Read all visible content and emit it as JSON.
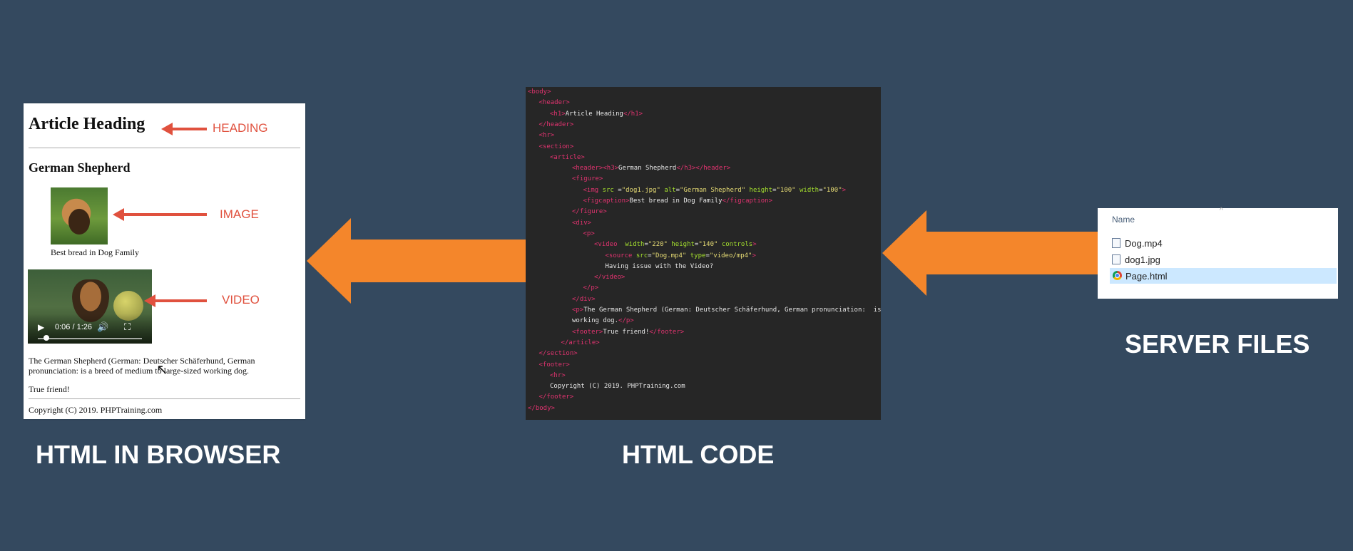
{
  "browser": {
    "heading": "Article Heading",
    "heading_annotation": "HEADING",
    "subheading": "German Shepherd",
    "image_annotation": "IMAGE",
    "caption": "Best bread in Dog Family",
    "video_annotation": "VIDEO",
    "video_time": "0:06 / 1:26",
    "paragraph": "The German Shepherd (German: Deutscher Schäferhund, German pronunciation: is a breed of medium to large-sized working dog.",
    "footer_text": "True friend!",
    "copyright": "Copyright (C) 2019. PHPTraining.com"
  },
  "code": {
    "lines": [
      {
        "indent": 0,
        "parts": [
          [
            "tg",
            "<body>"
          ]
        ]
      },
      {
        "indent": 1,
        "parts": [
          [
            "tg",
            "<header>"
          ]
        ]
      },
      {
        "indent": 2,
        "parts": [
          [
            "tg",
            "<h1>"
          ],
          [
            "tx",
            "Article Heading"
          ],
          [
            "tg",
            "</h1>"
          ]
        ]
      },
      {
        "indent": 1,
        "parts": [
          [
            "tg",
            "</header>"
          ]
        ]
      },
      {
        "indent": 1,
        "parts": [
          [
            "tg",
            "<hr>"
          ]
        ]
      },
      {
        "indent": 1,
        "parts": [
          [
            "tg",
            "<section>"
          ]
        ]
      },
      {
        "indent": 2,
        "parts": [
          [
            "tg",
            "<article>"
          ]
        ]
      },
      {
        "indent": 4,
        "parts": [
          [
            "tg",
            "<header>"
          ],
          [
            "tg",
            "<h3>"
          ],
          [
            "tx",
            "German Shepherd"
          ],
          [
            "tg",
            "</h3>"
          ],
          [
            "tg",
            "</header>"
          ]
        ]
      },
      {
        "indent": 4,
        "parts": [
          [
            "tg",
            "<figure>"
          ]
        ]
      },
      {
        "indent": 5,
        "parts": [
          [
            "tg",
            "<img "
          ],
          [
            "at",
            "src"
          ],
          [
            "tx",
            " ="
          ],
          [
            "st",
            "\"dog1.jpg\""
          ],
          [
            "tx",
            " "
          ],
          [
            "at",
            "alt"
          ],
          [
            "tx",
            "="
          ],
          [
            "st",
            "\"German Shepherd\""
          ],
          [
            "tx",
            " "
          ],
          [
            "at",
            "height"
          ],
          [
            "tx",
            "="
          ],
          [
            "st",
            "\"100\""
          ],
          [
            "tx",
            " "
          ],
          [
            "at",
            "width"
          ],
          [
            "tx",
            "="
          ],
          [
            "st",
            "\"100\""
          ],
          [
            "tg",
            ">"
          ]
        ]
      },
      {
        "indent": 5,
        "parts": [
          [
            "tg",
            "<figcaption>"
          ],
          [
            "tx",
            "Best bread in Dog Family"
          ],
          [
            "tg",
            "</figcaption>"
          ]
        ]
      },
      {
        "indent": 4,
        "parts": [
          [
            "tg",
            "</figure>"
          ]
        ]
      },
      {
        "indent": 4,
        "parts": [
          [
            "tg",
            "<div>"
          ]
        ]
      },
      {
        "indent": 5,
        "parts": [
          [
            "tg",
            "<p>"
          ]
        ]
      },
      {
        "indent": 6,
        "parts": [
          [
            "tg",
            "<video "
          ],
          [
            "at",
            " width"
          ],
          [
            "tx",
            "="
          ],
          [
            "st",
            "\"220\""
          ],
          [
            "tx",
            " "
          ],
          [
            "at",
            "height"
          ],
          [
            "tx",
            "="
          ],
          [
            "st",
            "\"140\""
          ],
          [
            "tx",
            " "
          ],
          [
            "at",
            "controls"
          ],
          [
            "tg",
            ">"
          ]
        ]
      },
      {
        "indent": 7,
        "parts": [
          [
            "tg",
            "<source "
          ],
          [
            "at",
            "src"
          ],
          [
            "tx",
            "="
          ],
          [
            "st",
            "\"Dog.mp4\""
          ],
          [
            "tx",
            " "
          ],
          [
            "at",
            "type"
          ],
          [
            "tx",
            "="
          ],
          [
            "st",
            "\"video/mp4\""
          ],
          [
            "tg",
            ">"
          ]
        ]
      },
      {
        "indent": 7,
        "parts": [
          [
            "tx",
            "Having issue with the Video?"
          ]
        ]
      },
      {
        "indent": 6,
        "parts": [
          [
            "tg",
            "</video>"
          ]
        ]
      },
      {
        "indent": 5,
        "parts": [
          [
            "tg",
            "</p>"
          ]
        ]
      },
      {
        "indent": 4,
        "parts": [
          [
            "tg",
            "</div>"
          ]
        ]
      },
      {
        "indent": 4,
        "parts": [
          [
            "tg",
            "<p>"
          ],
          [
            "tx",
            "The German Shepherd (German: Deutscher Schäferhund, German pronunciation:  is a breed of medium to large-sized"
          ]
        ]
      },
      {
        "indent": 4,
        "parts": [
          [
            "tx",
            "working dog."
          ],
          [
            "tg",
            "</p>"
          ]
        ]
      },
      {
        "indent": 4,
        "parts": [
          [
            "tg",
            "<footer>"
          ],
          [
            "tx",
            "True friend!"
          ],
          [
            "tg",
            "</footer>"
          ]
        ]
      },
      {
        "indent": 3,
        "parts": [
          [
            "tg",
            "</article>"
          ]
        ]
      },
      {
        "indent": 1,
        "parts": [
          [
            "tg",
            "</section>"
          ]
        ]
      },
      {
        "indent": 1,
        "parts": [
          [
            "tg",
            "<footer>"
          ]
        ]
      },
      {
        "indent": 2,
        "parts": [
          [
            "tg",
            "<hr>"
          ]
        ]
      },
      {
        "indent": 2,
        "parts": [
          [
            "tx",
            "Copyright (C) 2019. PHPTraining.com"
          ]
        ]
      },
      {
        "indent": 1,
        "parts": [
          [
            "tg",
            "</footer>"
          ]
        ]
      },
      {
        "indent": 0,
        "parts": [
          [
            "tg",
            "</body>"
          ]
        ]
      }
    ]
  },
  "files": {
    "column_header": "Name",
    "items": [
      {
        "name": "Dog.mp4",
        "icon": "video-file-icon",
        "selected": false
      },
      {
        "name": "dog1.jpg",
        "icon": "image-file-icon",
        "selected": false
      },
      {
        "name": "Page.html",
        "icon": "chrome-icon",
        "selected": true
      }
    ]
  },
  "labels": {
    "browser": "HTML IN BROWSER",
    "code": "HTML CODE",
    "files": "SERVER FILES"
  },
  "colors": {
    "background": "#34495f",
    "arrow": "#f4862b",
    "annotation": "#e0513e"
  }
}
